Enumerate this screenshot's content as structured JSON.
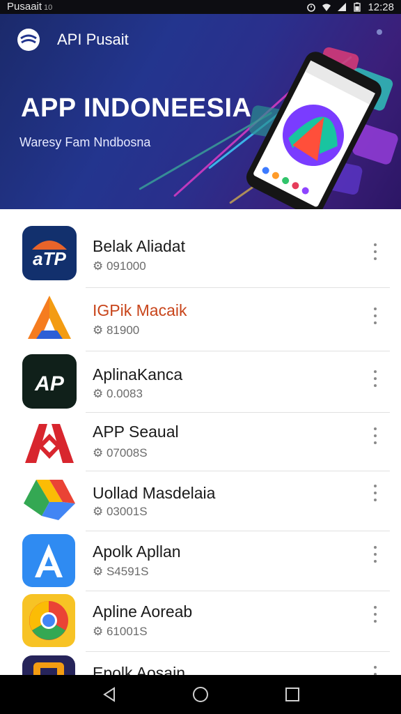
{
  "status_bar": {
    "carrier": "Pusaait",
    "carrier_sub": "10",
    "time": "12:28"
  },
  "hero": {
    "brand": "API Pusait",
    "title": "APP INDONEESIA",
    "subtitle": "Waresy Fam Nndbosna"
  },
  "apps": [
    {
      "name": "Belak Aliadat",
      "meta": "⚙ 091000"
    },
    {
      "name": "IGPik Macaik",
      "meta": "⚙ 81900"
    },
    {
      "name": "AplinaKanca",
      "meta": "⚙ 0.0083"
    },
    {
      "name": "APP Seaual",
      "meta": "⚙ 07008S"
    },
    {
      "name": "Uollad Masdelaia",
      "meta": "⚙ 03001S"
    },
    {
      "name": "Apolk Apllan",
      "meta": "⚙ S4591S"
    },
    {
      "name": "Apline Aoreab",
      "meta": "⚙ 61001S"
    },
    {
      "name": "Epolk Aosain",
      "meta": ""
    }
  ],
  "icons": {
    "menu": "more-vert-icon",
    "nav_back": "back-triangle-icon",
    "nav_home": "home-circle-icon",
    "nav_recents": "recents-square-icon"
  },
  "colors": {
    "hero_start": "#1b2a6b",
    "hero_end": "#2c1665",
    "accent_orange": "#c8451b"
  }
}
